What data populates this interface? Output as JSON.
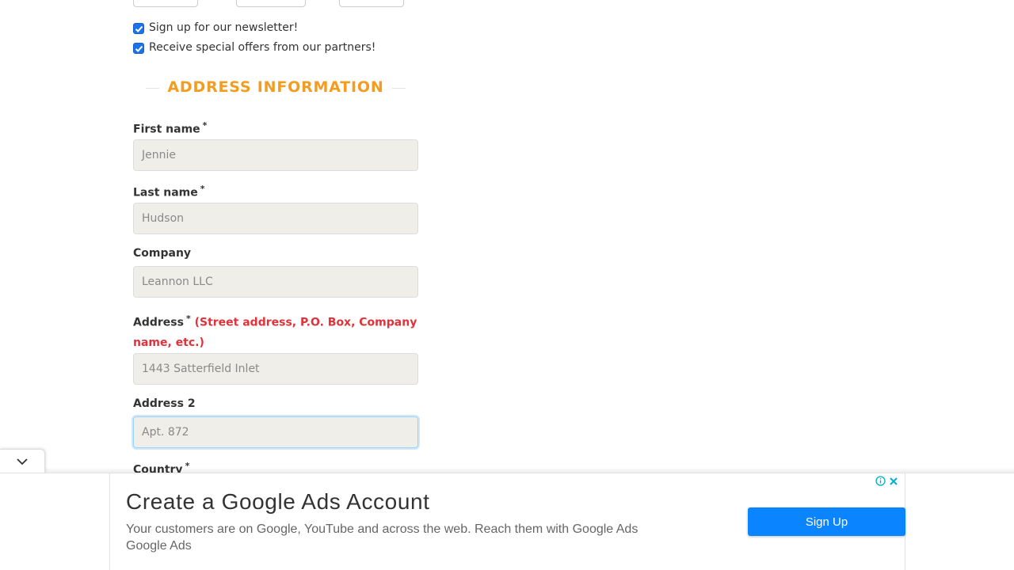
{
  "newsletter": {
    "options": [
      {
        "label": "Sign up for our newsletter!",
        "checked": true
      },
      {
        "label": "Receive special offers from our partners!",
        "checked": true
      }
    ]
  },
  "section": {
    "title": "ADDRESS INFORMATION"
  },
  "fields": {
    "first_name": {
      "label": "First name",
      "required": "*",
      "placeholder": "Jennie"
    },
    "last_name": {
      "label": "Last name",
      "required": "*",
      "placeholder": "Hudson"
    },
    "company": {
      "label": "Company",
      "placeholder": "Leannon LLC"
    },
    "address": {
      "label": "Address",
      "required": "*",
      "hint": "(Street address, P.O. Box, Company name, etc.)",
      "placeholder": "1443 Satterfield Inlet"
    },
    "address2": {
      "label": "Address 2",
      "placeholder": "Apt. 872"
    },
    "country": {
      "label": "Country",
      "required": "*"
    }
  },
  "ad": {
    "title": "Create a Google Ads Account",
    "description": "Your customers are on Google, YouTube and across the web. Reach them with Google Ads",
    "advertiser": "Google Ads",
    "button_label": "Sign Up",
    "icons": [
      "adchoices-info-icon",
      "close-icon",
      "chevron-down-icon"
    ]
  },
  "colors": {
    "accent": "#f39c1f",
    "hint": "#e0323a",
    "ad_button": "#0a84ff",
    "input_bg": "#efeee8",
    "checkbox": "#1a73e8"
  }
}
